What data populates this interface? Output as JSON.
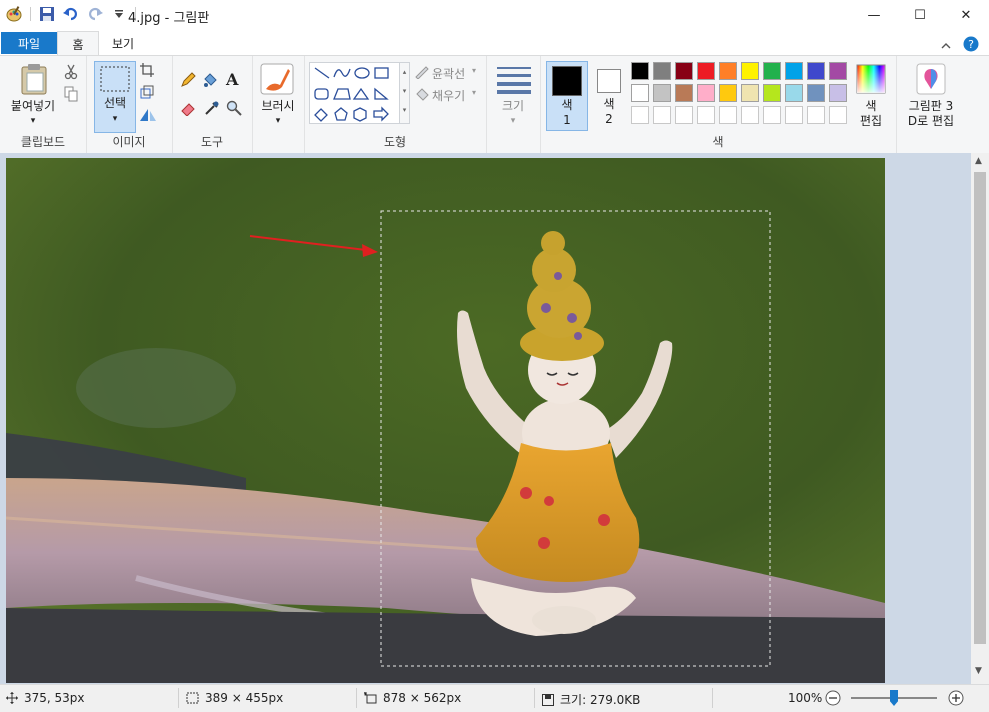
{
  "window": {
    "title": "4.jpg - 그림판",
    "controls": {
      "minimize": "—",
      "maximize": "☐",
      "close": "✕"
    }
  },
  "tabs": {
    "file": "파일",
    "home": "홈",
    "view": "보기"
  },
  "ribbon": {
    "clipboard": {
      "paste": "붙여넣기",
      "group_label": "클립보드"
    },
    "image": {
      "select": "선택",
      "group_label": "이미지"
    },
    "tools": {
      "group_label": "도구",
      "text_glyph": "A"
    },
    "brushes": {
      "label": "브러시"
    },
    "shapes": {
      "outline": "윤곽선",
      "fill": "채우기",
      "group_label": "도형"
    },
    "size": {
      "label": "크기"
    },
    "colors": {
      "color1": "색\n1",
      "color1_a": "색",
      "color1_b": "1",
      "color2_a": "색",
      "color2_b": "2",
      "edit_a": "색",
      "edit_b": "편집",
      "group_label": "색",
      "color1_value": "#000000",
      "color2_value": "#ffffff",
      "palette_row1": [
        "#000000",
        "#7f7f7f",
        "#880015",
        "#ed1c24",
        "#ff7f27",
        "#fff200",
        "#22b14c",
        "#00a2e8",
        "#3f48cc",
        "#a349a4"
      ],
      "palette_row2": [
        "#ffffff",
        "#c3c3c3",
        "#b97a57",
        "#ffaec9",
        "#ffc90e",
        "#efe4b0",
        "#b5e61d",
        "#99d9ea",
        "#7092be",
        "#c8bfe7"
      ],
      "palette_row3": [
        "#ffffff",
        "#ffffff",
        "#ffffff",
        "#ffffff",
        "#ffffff",
        "#ffffff",
        "#ffffff",
        "#ffffff",
        "#ffffff",
        "#ffffff"
      ]
    },
    "paint3d": {
      "line1": "그림판 3",
      "line2": "D로 편집"
    }
  },
  "status": {
    "cursor_pos": "375, 53px",
    "selection_size": "389 × 455px",
    "image_size": "878 × 562px",
    "file_size": "크기: 279.0KB",
    "zoom": "100%",
    "zoom_percent": 100
  }
}
